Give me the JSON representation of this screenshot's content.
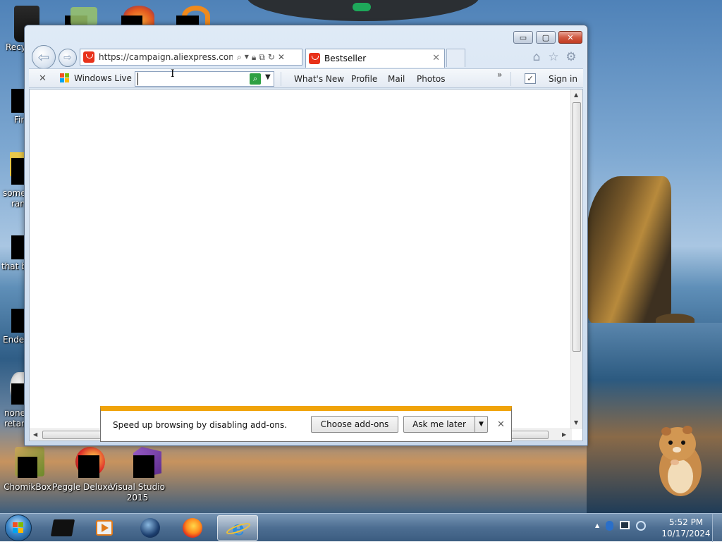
{
  "desktop": {
    "icons": [
      {
        "label": "ChomikBox"
      },
      {
        "label": "Peggle Deluxe"
      },
      {
        "label": "Visual Studio 2015"
      }
    ],
    "partial_labels": [
      "Recy",
      "Fir",
      "some",
      "ran",
      "that b",
      "Ender",
      "none",
      "retarc"
    ]
  },
  "browser": {
    "address_url": "https://campaign.aliexpress.com/w",
    "tab_title": "Bestseller",
    "window_buttons": {
      "minimize": "▭",
      "maximize": "▢",
      "close": "✕"
    },
    "toolbar": {
      "windows_live_label": "Windows Live",
      "search_value": "",
      "links": [
        "What's New",
        "Profile",
        "Mail",
        "Photos"
      ],
      "more_chevron": "»",
      "sign_in_label": "Sign in"
    }
  },
  "notification": {
    "message": "Speed up browsing by disabling add-ons.",
    "choose_label": "Choose add-ons",
    "ask_later_label": "Ask me later",
    "close_glyph": "✕"
  },
  "taskbar": {
    "clock_time": "5:52 PM",
    "clock_date": "10/17/2024",
    "tray_chevron": "▲"
  },
  "colors": {
    "notification_accent": "#f0a30a",
    "aliexpress_red": "#e8321a",
    "close_button_red": "#c13b22"
  }
}
